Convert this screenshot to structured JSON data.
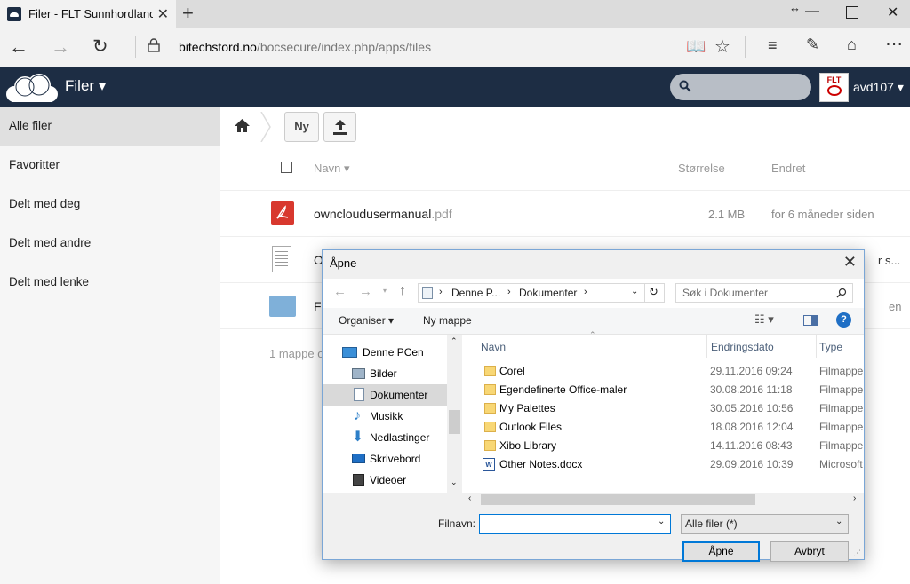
{
  "browser": {
    "tab_title": "Filer - FLT Sunnhordland",
    "url_domain": "bitechstord.no",
    "url_path": "/bocsecure/index.php/apps/files"
  },
  "header": {
    "app_name": "Filer ▾",
    "username": "avd107 ▾",
    "avatar_text": "FLT"
  },
  "sidebar": {
    "items": [
      {
        "label": "Alle filer"
      },
      {
        "label": "Favoritter"
      },
      {
        "label": "Delt med deg"
      },
      {
        "label": "Delt med andre"
      },
      {
        "label": "Delt med lenke"
      }
    ]
  },
  "toolbar": {
    "new_label": "Ny"
  },
  "table": {
    "col_name": "Navn ▾",
    "col_size": "Størrelse",
    "col_modified": "Endret",
    "rows": [
      {
        "name": "ownclouduser­manual",
        "display_name": "owncloudusermanual",
        "ext": ".pdf",
        "size": "2.1 MB",
        "modified": "for 6 måneder siden"
      },
      {
        "name": "O",
        "ext": "",
        "size": "",
        "modified": "r s..."
      },
      {
        "name": "Fl",
        "ext": "",
        "size": "",
        "modified": "en"
      }
    ],
    "summary": "1 mappe o"
  },
  "dialog": {
    "title": "Åpne",
    "breadcrumb": [
      "Denne P...",
      "Dokumenter"
    ],
    "search_placeholder": "Søk i Dokumenter",
    "organize_label": "Organiser ▾",
    "new_folder_label": "Ny mappe",
    "tree": [
      {
        "label": "Denne PCen",
        "indent": false
      },
      {
        "label": "Bilder",
        "indent": true
      },
      {
        "label": "Dokumenter",
        "indent": true,
        "selected": true
      },
      {
        "label": "Musikk",
        "indent": true
      },
      {
        "label": "Nedlastinger",
        "indent": true
      },
      {
        "label": "Skrivebord",
        "indent": true
      },
      {
        "label": "Videoer",
        "indent": true
      }
    ],
    "columns": {
      "name": "Navn",
      "date": "Endringsdato",
      "type": "Type"
    },
    "files": [
      {
        "name": "Corel",
        "date": "29.11.2016 09:24",
        "type": "Filmappe",
        "kind": "folder"
      },
      {
        "name": "Egendefinerte Office-maler",
        "date": "30.08.2016 11:18",
        "type": "Filmappe",
        "kind": "folder"
      },
      {
        "name": "My Palettes",
        "date": "30.05.2016 10:56",
        "type": "Filmappe",
        "kind": "folder"
      },
      {
        "name": "Outlook Files",
        "date": "18.08.2016 12:04",
        "type": "Filmappe",
        "kind": "folder"
      },
      {
        "name": "Xibo Library",
        "date": "14.11.2016 08:43",
        "type": "Filmappe",
        "kind": "folder"
      },
      {
        "name": "Other Notes.docx",
        "date": "29.09.2016 10:39",
        "type": "Microsoft",
        "kind": "docx"
      }
    ],
    "filename_label": "Filnavn:",
    "filename_value": "",
    "filter_value": "Alle filer (*)",
    "open_label": "Åpne",
    "cancel_label": "Avbryt"
  }
}
